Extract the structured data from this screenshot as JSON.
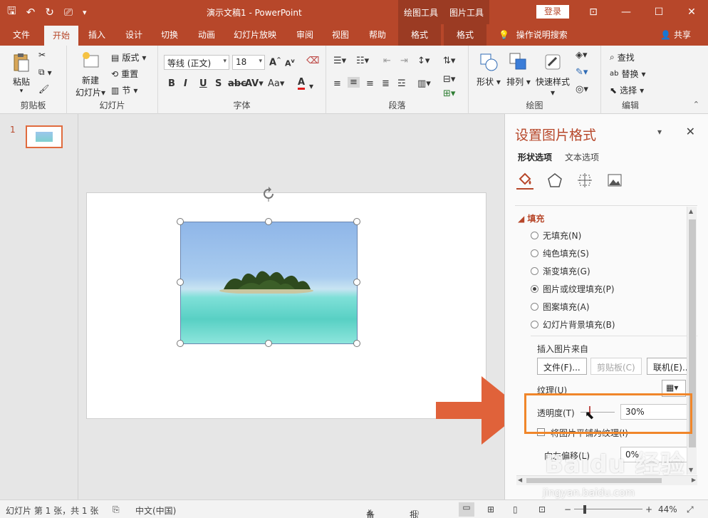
{
  "window": {
    "title": "演示文稿1 - PowerPoint",
    "context_tab_drawing": "绘图工具",
    "context_tab_picture": "图片工具",
    "login": "登录"
  },
  "tabs": {
    "file": "文件",
    "home": "开始",
    "insert": "插入",
    "design": "设计",
    "transitions": "切换",
    "animations": "动画",
    "slideshow": "幻灯片放映",
    "review": "审阅",
    "view": "视图",
    "help": "帮助",
    "format1": "格式",
    "format2": "格式",
    "tell_me": "操作说明搜索",
    "share": "共享"
  },
  "ribbon": {
    "clipboard": {
      "label": "剪贴板",
      "paste": "粘贴"
    },
    "slides": {
      "label": "幻灯片",
      "new_slide_1": "新建",
      "new_slide_2": "幻灯片",
      "layout": "版式",
      "reset": "重置",
      "section": "节"
    },
    "font": {
      "label": "字体",
      "font_name": "等线 (正文)",
      "font_size": "18"
    },
    "paragraph": {
      "label": "段落"
    },
    "drawing": {
      "label": "绘图",
      "shapes": "形状",
      "arrange": "排列",
      "quick_styles": "快速样式"
    },
    "editing": {
      "label": "编辑",
      "find": "查找",
      "replace": "替换",
      "select": "选择"
    }
  },
  "thumbs": {
    "number": "1"
  },
  "pane": {
    "title": "设置图片格式",
    "tab_shape": "形状选项",
    "tab_text": "文本选项",
    "section_fill": "填充",
    "options": [
      {
        "label": "无填充(N)",
        "selected": false
      },
      {
        "label": "纯色填充(S)",
        "selected": false
      },
      {
        "label": "渐变填充(G)",
        "selected": false
      },
      {
        "label": "图片或纹理填充(P)",
        "selected": true
      },
      {
        "label": "图案填充(A)",
        "selected": false
      },
      {
        "label": "幻灯片背景填充(B)",
        "selected": false
      }
    ],
    "insert_from": "插入图片来自",
    "btn_file": "文件(F)...",
    "btn_clipboard": "剪贴板(C)",
    "btn_online": "联机(E)...",
    "texture": "纹理(U)",
    "transparency": "透明度(T)",
    "transparency_value": "30%",
    "tile": "将图片平铺为纹理(I)",
    "offset_left": "向左偏移(L)",
    "offset_left_value": "0%"
  },
  "status": {
    "slide_info": "幻灯片 第 1 张，共 1 张",
    "language": "中文(中国)",
    "notes": "备注",
    "comments": "批注",
    "zoom": "44%"
  },
  "watermark": {
    "brand": "Baidu 经验",
    "url": "jingyan.baidu.com"
  },
  "colors": {
    "accent": "#b7472a",
    "highlight": "#f0862a",
    "arrow": "#e0623a"
  }
}
